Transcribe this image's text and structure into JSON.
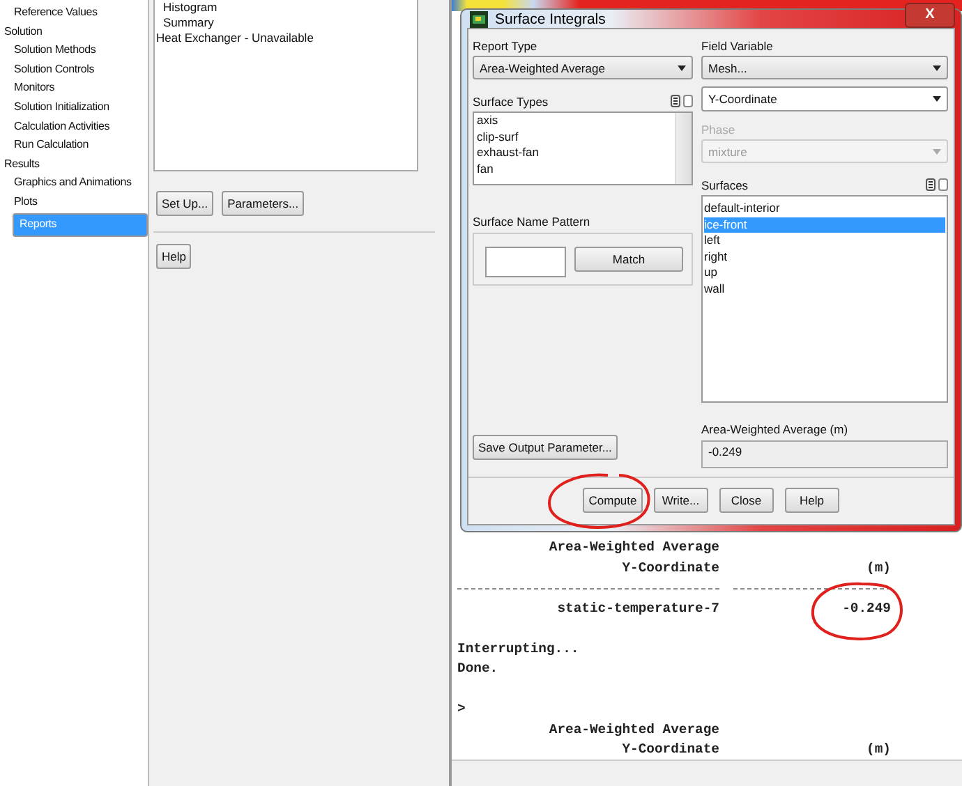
{
  "tree": [
    {
      "items": [
        {
          "label": "Reference Values",
          "selected": false
        }
      ]
    },
    {
      "label": "Solution",
      "items": [
        {
          "label": "Solution Methods",
          "selected": false
        },
        {
          "label": "Solution Controls",
          "selected": false
        },
        {
          "label": "Monitors",
          "selected": false
        },
        {
          "label": "Solution Initialization",
          "selected": false
        },
        {
          "label": "Calculation Activities",
          "selected": false
        },
        {
          "label": "Run Calculation",
          "selected": false
        }
      ]
    },
    {
      "label": "Results",
      "items": [
        {
          "label": "Graphics and Animations",
          "selected": false
        },
        {
          "label": "Plots",
          "selected": false
        },
        {
          "label": "Reports",
          "selected": true
        }
      ]
    }
  ],
  "reports_panel": {
    "items": [
      {
        "label": "Histogram",
        "kind": "sub"
      },
      {
        "label": "Summary",
        "kind": "sub"
      },
      {
        "label": "Heat Exchanger - Unavailable",
        "kind": "top"
      }
    ],
    "buttons": [
      "Set Up...",
      "Parameters..."
    ],
    "help_button": "Help"
  },
  "dialog": {
    "title": "Surface Integrals",
    "close": "X",
    "report_type": {
      "label": "Report Type",
      "value": "Area-Weighted Average"
    },
    "surface_types": {
      "label": "Surface Types",
      "items": [
        "axis",
        "clip-surf",
        "exhaust-fan",
        "fan"
      ]
    },
    "surface_name_pattern": {
      "label": "Surface Name Pattern",
      "button": "Match"
    },
    "save_button": "Save Output Parameter...",
    "field_variable": {
      "label": "Field Variable",
      "value": "Mesh...",
      "sub_value": "Y-Coordinate"
    },
    "phase": {
      "label": "Phase",
      "value": "mixture",
      "disabled": true
    },
    "surfaces": {
      "label": "Surfaces",
      "items": [
        {
          "label": "default-interior",
          "selected": false
        },
        {
          "label": "ice-front",
          "selected": true
        },
        {
          "label": "left",
          "selected": false
        },
        {
          "label": "right",
          "selected": false
        },
        {
          "label": "up",
          "selected": false
        },
        {
          "label": "wall",
          "selected": false
        }
      ]
    },
    "result": {
      "label": "Area-Weighted Average (m)",
      "value": "-0.249"
    },
    "buttons": [
      "Compute",
      "Write...",
      "Close",
      "Help"
    ]
  },
  "console": [
    {
      "kind": "head",
      "label": "Area-Weighted Average"
    },
    {
      "kind": "head",
      "label": "Y-Coordinate",
      "value": "(m)"
    },
    {
      "kind": "rule"
    },
    {
      "kind": "row",
      "label": "static-temperature-7",
      "value": "-0.249"
    },
    {
      "kind": "blank"
    },
    {
      "kind": "text",
      "text": "Interrupting..."
    },
    {
      "kind": "text",
      "text": "Done."
    },
    {
      "kind": "blank"
    },
    {
      "kind": "text",
      "text": ">"
    },
    {
      "kind": "head",
      "label": "Area-Weighted Average"
    },
    {
      "kind": "head",
      "label": "Y-Coordinate",
      "value": "(m)"
    }
  ]
}
